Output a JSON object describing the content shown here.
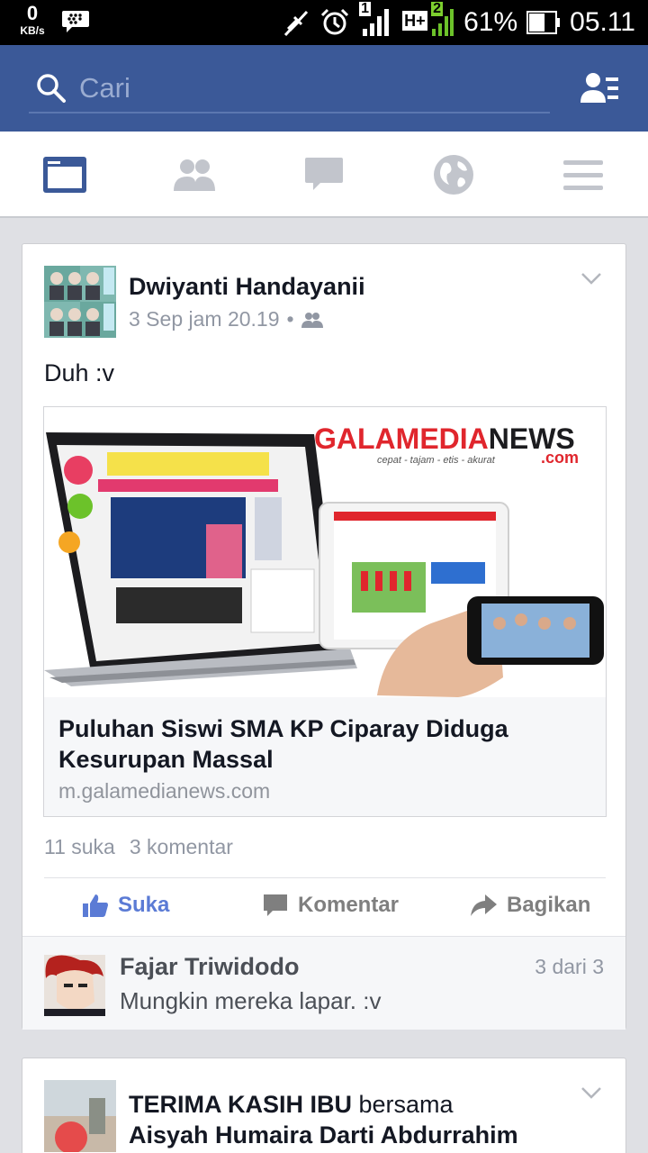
{
  "status_bar": {
    "speed_value": "0",
    "speed_unit": "KB/s",
    "sim1": "1",
    "network_type": "H+",
    "sim2": "2",
    "battery_percent": "61%",
    "battery_level": 0.61,
    "time": "05.11"
  },
  "search": {
    "placeholder": "Cari"
  },
  "nav": {
    "tabs": [
      "news-feed",
      "friend-requests",
      "messages",
      "notifications",
      "more"
    ],
    "active": "news-feed",
    "accent": "#3b5998"
  },
  "post1": {
    "author": "Dwiyanti Handayanii",
    "timestamp": "3 Sep jam 20.19",
    "separator": "•",
    "text": "Duh :v",
    "link": {
      "brand_main": "GALAMEDIANEWS",
      "brand_sub": ".com",
      "tagline": "cepat - tajam - etis - akurat",
      "title": "Puluhan Siswi SMA KP Ciparay Diduga Kesurupan Massal",
      "domain": "m.galamedianews.com"
    },
    "likes": "11 suka",
    "comments": "3 komentar",
    "actions": {
      "like": "Suka",
      "comment": "Komentar",
      "share": "Bagikan"
    },
    "top_comment": {
      "name": "Fajar Triwidodo",
      "count": "3 dari 3",
      "text": "Mungkin mereka lapar. :v"
    }
  },
  "post2": {
    "author": "TERIMA KASIH IBU",
    "connector": " bersama",
    "with": "Aisyah Humaira Darti Abdurrahim"
  },
  "colors": {
    "header": "#3b5998",
    "like_blue": "#5b7bd5",
    "brand_red": "#e0262d"
  }
}
